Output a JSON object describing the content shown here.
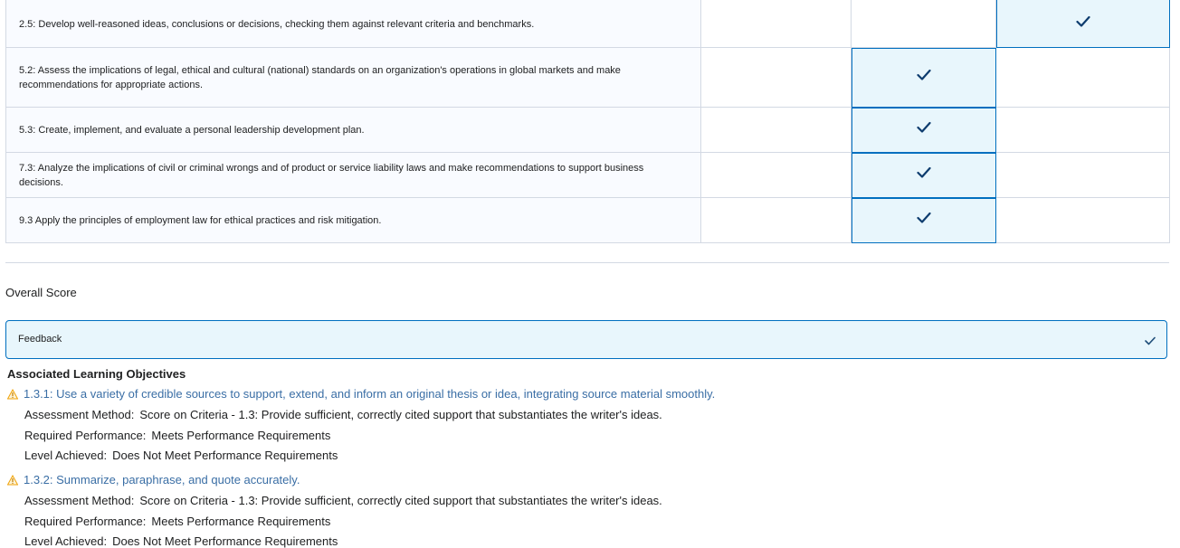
{
  "rubric_rows": [
    {
      "criterion": "2.5: Develop well-reasoned ideas, conclusions or decisions, checking them against relevant criteria and benchmarks.",
      "selected_col": 3
    },
    {
      "criterion": "5.2: Assess the implications of legal, ethical and cultural (national) standards on an organization's operations in global markets and make recommendations for appropriate actions.",
      "selected_col": 2
    },
    {
      "criterion": "5.3: Create, implement, and evaluate a personal leadership development plan.",
      "selected_col": 2
    },
    {
      "criterion": "7.3: Analyze the implications of civil or criminal wrongs and of product or service liability laws and make recommendations to support business decisions.",
      "selected_col": 2
    },
    {
      "criterion": "9.3 Apply the principles of employment law for ethical practices and risk mitigation.",
      "selected_col": 2
    }
  ],
  "overall_score_label": "Overall Score",
  "feedback_label": "Feedback",
  "associated_title": "Associated Learning Objectives",
  "objectives": [
    {
      "title": "1.3.1: Use a variety of credible sources to support, extend, and inform an original thesis or idea, integrating source material smoothly.",
      "assessment_key": "Assessment Method:",
      "assessment_value": "Score on Criteria - 1.3: Provide sufficient, correctly cited support that substantiates the writer's ideas.",
      "required_key": "Required Performance:",
      "required_value": "Meets Performance Requirements",
      "level_key": "Level Achieved:",
      "level_value": "Does Not Meet Performance Requirements"
    },
    {
      "title": "1.3.2: Summarize, paraphrase, and quote accurately.",
      "assessment_key": "Assessment Method:",
      "assessment_value": "Score on Criteria - 1.3: Provide sufficient, correctly cited support that substantiates the writer's ideas.",
      "required_key": "Required Performance:",
      "required_value": "Meets Performance Requirements",
      "level_key": "Level Achieved:",
      "level_value": "Does Not Meet Performance Requirements"
    }
  ],
  "colors": {
    "accent": "#006fbf",
    "selected_bg": "#e8f6fc",
    "link": "#3a6ea5",
    "warning": "#f0a30a"
  },
  "icons": {
    "check": "checkmark-icon",
    "warning": "warning-icon"
  }
}
